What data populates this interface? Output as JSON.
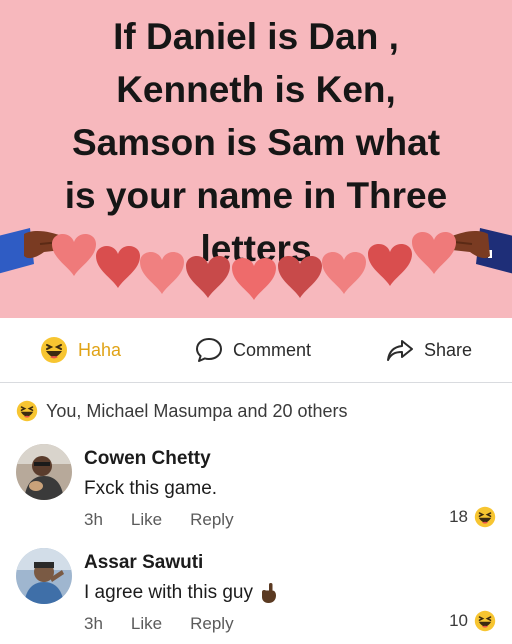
{
  "post": {
    "text_lines": [
      "If Daniel is Dan ,",
      "Kenneth is Ken,",
      "Samson is Sam what",
      "is your name in Three",
      "letters"
    ]
  },
  "actions": {
    "haha_label": "Haha",
    "comment_label": "Comment",
    "share_label": "Share"
  },
  "reactions": {
    "summary": "You, Michael Masumpa and 20 others"
  },
  "comments": [
    {
      "author": "Cowen Chetty",
      "text": "Fxck this game.",
      "time": "3h",
      "like": "Like",
      "reply": "Reply",
      "reaction_count": "18"
    },
    {
      "author": "Assar Sawuti",
      "text": "I agree with this guy",
      "time": "3h",
      "like": "Like",
      "reply": "Reply",
      "reaction_count": "10"
    }
  ],
  "colors": {
    "image_bg": "#f7b8bd",
    "heart_red": "#e85c5c",
    "heart_dark": "#c84a4a",
    "haha_yellow": "#f7c531",
    "haha_label": "#e0a317"
  },
  "icons": [
    "haha-icon",
    "comment-icon",
    "share-icon",
    "pointing-hand-icon"
  ]
}
